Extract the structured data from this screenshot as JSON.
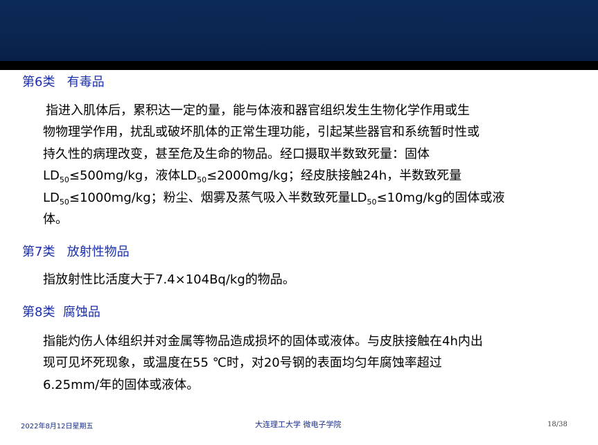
{
  "colors": {
    "header_band": "#0c2a57",
    "header_rule": "#000000",
    "category_text": "#1a2eaa",
    "body_text": "#000000",
    "footer_text": "#1a2e8a"
  },
  "sections": [
    {
      "title": "第6类   有毒品",
      "lines": [
        "指进入肌体后，累积达一定的量，能与体液和器官组织发生生物化学作用或生",
        "物物理学作用，扰乱或破坏肌体的正常生理功能，引起某些器官和系统暂时性或",
        "持久性的病理改变，甚至危及生命的物品。经口摄取半数致死量：固体"
      ],
      "ld_line_1": {
        "a": "LD",
        "sub_a": "50",
        "b": "≤500mg/kg，液体LD",
        "sub_b": "50",
        "c": "≤2000mg/kg；经皮肤接触24h，半数致死量"
      },
      "ld_line_2": {
        "a": "LD",
        "sub_a": "50",
        "b": "≤1000mg/kg；粉尘、烟雾及蒸气吸入半数致死量LD",
        "sub_b": "50",
        "c": "≤10mg/kg的固体或液"
      },
      "last_line": "体。"
    },
    {
      "title": "第7类   放射性物品",
      "lines": [
        "指放射性比活度大于7.4×104Bq/kg的物品。"
      ]
    },
    {
      "title": "第8类  腐蚀品",
      "lines": [
        "指能灼伤人体组织并对金属等物品造成损坏的固体或液体。与皮肤接触在4h内出",
        "现可见坏死现象，或温度在55 ℃时，对20号钢的表面均匀年腐蚀率超过",
        "6.25mm/年的固体或液体。"
      ]
    }
  ],
  "footer": {
    "date": "2022年8月12日星期五",
    "center": "大连理工大学  微电子学院",
    "page": "18/38"
  }
}
